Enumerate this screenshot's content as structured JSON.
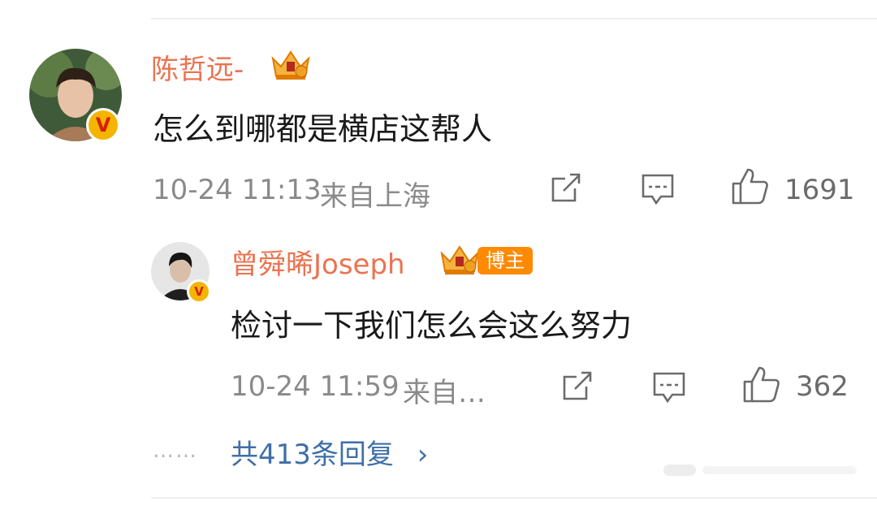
{
  "comment": {
    "username": "陈哲远-",
    "text": "怎么到哪都是横店这帮人",
    "time": "10-24 11:13",
    "location": "来自上海",
    "likes": "1691"
  },
  "reply": {
    "username": "曾舜晞Joseph",
    "badge": "博主",
    "text": "检讨一下我们怎么会这么努力",
    "time": "10-24 11:59",
    "location": "来自…",
    "likes": "362"
  },
  "more_replies": {
    "dots": "……",
    "label": "共413条回复",
    "chevron": "›"
  },
  "colors": {
    "username": "#eb7350",
    "link": "#3f6fa8",
    "meta": "#8a8a8a",
    "badge_bg": "#ff8a00",
    "verified": "#f5b400"
  },
  "icons": [
    "share-icon",
    "comment-icon",
    "like-icon",
    "crown-icon",
    "verified-icon",
    "chevron-right-icon"
  ]
}
